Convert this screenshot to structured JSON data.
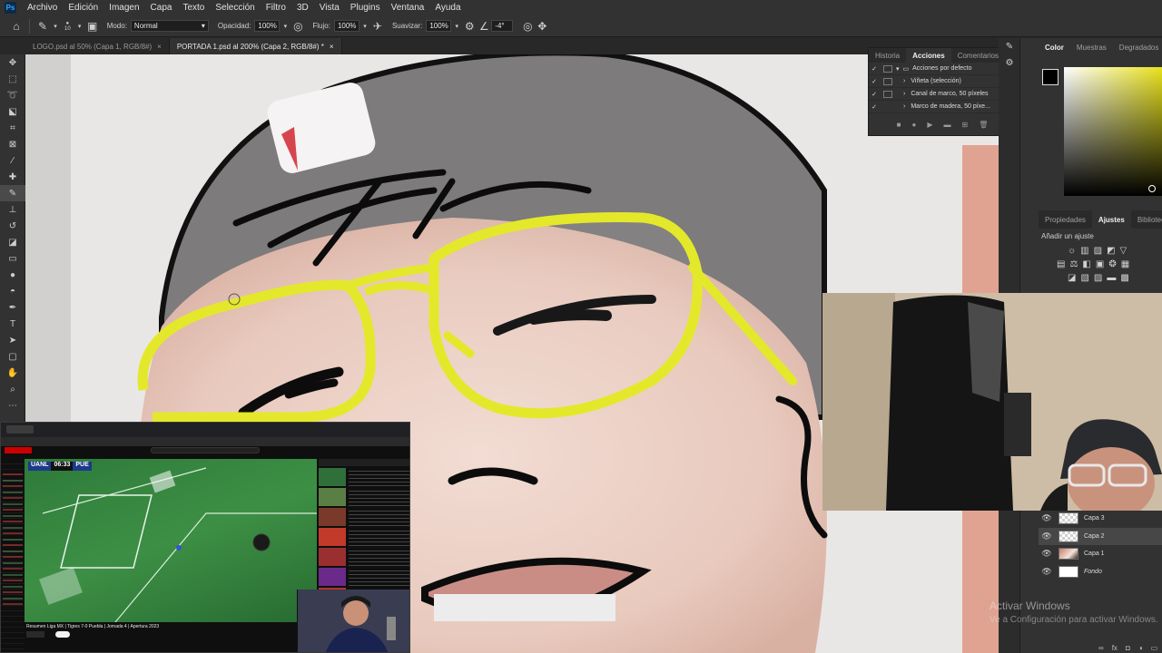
{
  "app": {
    "logo": "Ps"
  },
  "menu": [
    "Archivo",
    "Edición",
    "Imagen",
    "Capa",
    "Texto",
    "Selección",
    "Filtro",
    "3D",
    "Vista",
    "Plugins",
    "Ventana",
    "Ayuda"
  ],
  "options": {
    "brush_size": "10",
    "mode_label": "Modo:",
    "mode_value": "Normal",
    "opacity_label": "Opacidad:",
    "opacity_value": "100%",
    "flow_label": "Flujo:",
    "flow_value": "100%",
    "smoothing_label": "Suavizar:",
    "smoothing_value": "100%",
    "angle_value": "-4°"
  },
  "tabs": [
    {
      "label": "LOGO.psd al 50% (Capa 1, RGB/8#)",
      "close": "×"
    },
    {
      "label": "PORTADA 1.psd al 200% (Capa 2, RGB/8#) *",
      "close": "×"
    }
  ],
  "actions_panel": {
    "tabs": [
      "Historia",
      "Acciones",
      "Comentarios"
    ],
    "rows": [
      {
        "label": "Acciones por defecto"
      },
      {
        "label": "Viñeta (selección)"
      },
      {
        "label": "Canal de marco, 50 píxeles"
      },
      {
        "label": "Marco de madera, 50 píxe..."
      }
    ]
  },
  "color_panel": {
    "tabs": [
      "Color",
      "Muestras",
      "Degradados"
    ]
  },
  "adjust_panel": {
    "tabs": [
      "Propiedades",
      "Ajustes",
      "Bibliotecas"
    ],
    "add_label": "Añadir un ajuste"
  },
  "layers": [
    {
      "name": "Capa 3"
    },
    {
      "name": "Capa 2"
    },
    {
      "name": "Capa 1"
    },
    {
      "name": "Fondo"
    }
  ],
  "stream": {
    "score_home": "UANL",
    "score_time": "06:33",
    "score_away": "PUE",
    "caption": "Resumen Liga MX | Tigres 7-0 Puebla | Jornada 4 | Apertura 2023"
  },
  "watermark": {
    "title": "Activar Windows",
    "subtitle": "Ve a Configuración para activar Windows."
  },
  "colors": {
    "accent_yellow": "#e4e82a",
    "canvas_bg": "#e8e6e4",
    "panel_bg": "#323232"
  }
}
